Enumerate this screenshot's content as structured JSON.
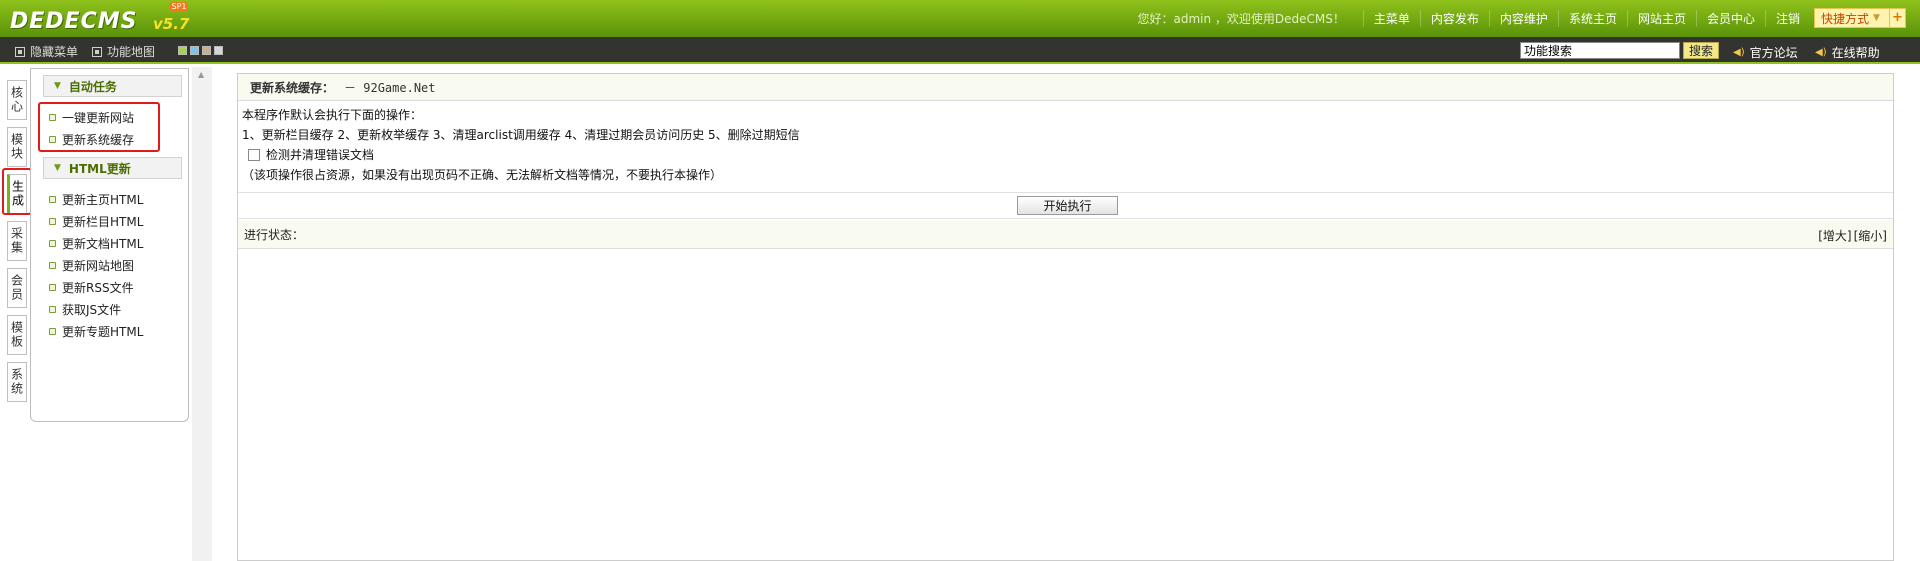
{
  "header": {
    "logo_text": "DEDECMS",
    "logo_version": "v5.7",
    "logo_badge": "SP1",
    "greeting": "您好：admin ，欢迎使用DedeCMS！",
    "nav": [
      "主菜单",
      "内容发布",
      "内容维护",
      "系统主页",
      "网站主页",
      "会员中心",
      "注销"
    ],
    "quick_label": "快捷方式",
    "quick_plus": "+"
  },
  "subbar": {
    "hide_menu": "隐藏菜单",
    "func_map": "功能地图",
    "swatch_colors": [
      "#a7d54a",
      "#7cc3e8",
      "#c9b08c",
      "#d6d6d6"
    ],
    "search_value": "功能搜索",
    "search_button": "搜索",
    "links": [
      "官方论坛",
      "在线帮助"
    ]
  },
  "vtabs": [
    "核心",
    "模块",
    "生成",
    "采集",
    "会员",
    "模板",
    "系统"
  ],
  "menu": {
    "groups": [
      {
        "title": "自动任务",
        "items": [
          "一键更新网站",
          "更新系统缓存"
        ]
      },
      {
        "title": "HTML更新",
        "items": [
          "更新主页HTML",
          "更新栏目HTML",
          "更新文档HTML",
          "更新网站地图",
          "更新RSS文件",
          "获取JS文件",
          "更新专题HTML"
        ]
      }
    ]
  },
  "main": {
    "title": "更新系统缓存：",
    "site": "－ 92Game.Net",
    "intro": "本程序作默认会执行下面的操作：",
    "ops": "1、更新栏目缓存 2、更新枚举缓存 3、清理arclist调用缓存 4、清理过期会员访问历史 5、删除过期短信",
    "check_label": "检测并清理错误文档",
    "note": "（该项操作很占资源，如果没有出现页码不正确、无法解析文档等情况，不要执行本操作）",
    "start_button": "开始执行",
    "status_label": "进行状态：",
    "zoom_in": "[增大]",
    "zoom_out": "[缩小]"
  },
  "colors": {
    "header_green": "#6fa612",
    "subbar_dark": "#33332f",
    "highlight_red": "#e11a1a"
  }
}
